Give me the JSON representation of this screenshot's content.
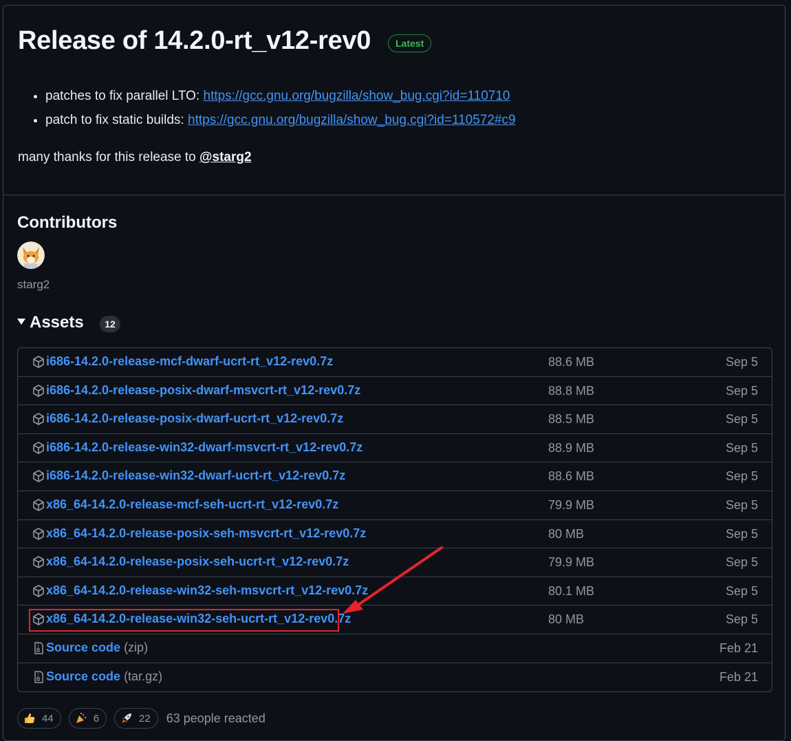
{
  "release": {
    "title": "Release of 14.2.0-rt_v12-rev0",
    "badge": "Latest",
    "notes": [
      {
        "text": "patches to fix parallel LTO: ",
        "link": "https://gcc.gnu.org/bugzilla/show_bug.cgi?id=110710"
      },
      {
        "text": "patch to fix static builds: ",
        "link": "https://gcc.gnu.org/bugzilla/show_bug.cgi?id=110572#c9"
      }
    ],
    "thanks_text": "many thanks for this release to ",
    "thanks_mention": "@starg2"
  },
  "contributors": {
    "heading": "Contributors",
    "users": [
      {
        "name": "starg2"
      }
    ]
  },
  "assets": {
    "heading": "Assets",
    "count": "12",
    "items": [
      {
        "name": "i686-14.2.0-release-mcf-dwarf-ucrt-rt_v12-rev0.7z",
        "size": "88.6 MB",
        "date": "Sep 5",
        "icon": "package-icon"
      },
      {
        "name": "i686-14.2.0-release-posix-dwarf-msvcrt-rt_v12-rev0.7z",
        "size": "88.8 MB",
        "date": "Sep 5",
        "icon": "package-icon"
      },
      {
        "name": "i686-14.2.0-release-posix-dwarf-ucrt-rt_v12-rev0.7z",
        "size": "88.5 MB",
        "date": "Sep 5",
        "icon": "package-icon"
      },
      {
        "name": "i686-14.2.0-release-win32-dwarf-msvcrt-rt_v12-rev0.7z",
        "size": "88.9 MB",
        "date": "Sep 5",
        "icon": "package-icon"
      },
      {
        "name": "i686-14.2.0-release-win32-dwarf-ucrt-rt_v12-rev0.7z",
        "size": "88.6 MB",
        "date": "Sep 5",
        "icon": "package-icon"
      },
      {
        "name": "x86_64-14.2.0-release-mcf-seh-ucrt-rt_v12-rev0.7z",
        "size": "79.9 MB",
        "date": "Sep 5",
        "icon": "package-icon"
      },
      {
        "name": "x86_64-14.2.0-release-posix-seh-msvcrt-rt_v12-rev0.7z",
        "size": "80 MB",
        "date": "Sep 5",
        "icon": "package-icon"
      },
      {
        "name": "x86_64-14.2.0-release-posix-seh-ucrt-rt_v12-rev0.7z",
        "size": "79.9 MB",
        "date": "Sep 5",
        "icon": "package-icon"
      },
      {
        "name": "x86_64-14.2.0-release-win32-seh-msvcrt-rt_v12-rev0.7z",
        "size": "80.1 MB",
        "date": "Sep 5",
        "icon": "package-icon"
      },
      {
        "name": "x86_64-14.2.0-release-win32-seh-ucrt-rt_v12-rev0.7z",
        "size": "80 MB",
        "date": "Sep 5",
        "icon": "package-icon",
        "highlighted": true
      },
      {
        "name": "Source code",
        "suffix": "(zip)",
        "size": "",
        "date": "Feb 21",
        "icon": "file-zip-icon"
      },
      {
        "name": "Source code",
        "suffix": "(tar.gz)",
        "size": "",
        "date": "Feb 21",
        "icon": "file-zip-icon"
      }
    ]
  },
  "reactions": {
    "items": [
      {
        "emoji": "thumbs-up",
        "count": "44"
      },
      {
        "emoji": "party-popper",
        "count": "6"
      },
      {
        "emoji": "rocket",
        "count": "22"
      }
    ],
    "summary": "63 people reacted"
  },
  "colors": {
    "background": "#0d1117",
    "link": "#4493f8",
    "latest_badge": "#3fb950",
    "annotation": "#e5242b"
  }
}
